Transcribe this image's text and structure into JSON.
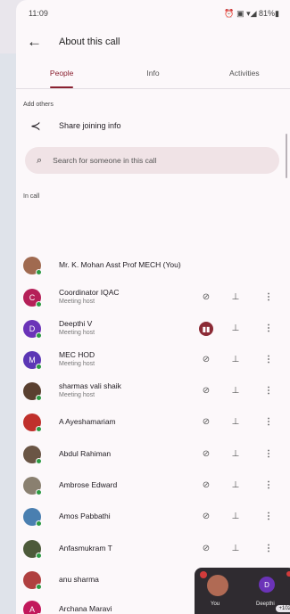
{
  "status": {
    "time": "11:09",
    "icons": "⏰ ▣ ▾◢ 81%▮"
  },
  "header": {
    "title": "About this call"
  },
  "tabs": [
    {
      "label": "People"
    },
    {
      "label": "Info"
    },
    {
      "label": "Activities"
    }
  ],
  "add_section": {
    "label": "Add others",
    "share_label": "Share joining info"
  },
  "search": {
    "placeholder": "Search for someone in this call"
  },
  "incall_label": "In call",
  "participants": [
    {
      "name": "Mr. K. Mohan Asst Prof MECH (You)",
      "sub": "",
      "initial": "",
      "color": "#a06a50"
    },
    {
      "name": "Coordinator IQAC",
      "sub": "Meeting host",
      "initial": "C",
      "color": "#b52058"
    },
    {
      "name": "Deepthi V",
      "sub": "Meeting host",
      "initial": "D",
      "color": "#6b33b8"
    },
    {
      "name": "MEC HOD",
      "sub": "Meeting host",
      "initial": "M",
      "color": "#5c37b5"
    },
    {
      "name": "sharmas vali shaik",
      "sub": "Meeting host",
      "initial": "",
      "color": "#5a4030"
    },
    {
      "name": "A Ayeshamariam",
      "sub": "",
      "initial": "",
      "color": "#c0302c"
    },
    {
      "name": "Abdul Rahiman",
      "sub": "",
      "initial": "",
      "color": "#6a5545"
    },
    {
      "name": "Ambrose Edward",
      "sub": "",
      "initial": "",
      "color": "#8a8070"
    },
    {
      "name": "Amos Pabbathi",
      "sub": "",
      "initial": "",
      "color": "#4a7fb0"
    },
    {
      "name": "Anfasmukram T",
      "sub": "",
      "initial": "",
      "color": "#4d5a3a"
    },
    {
      "name": "anu sharma",
      "sub": "",
      "initial": "",
      "color": "#b04040"
    },
    {
      "name": "Archana Maravi",
      "sub": "",
      "initial": "A",
      "color": "#c2185b"
    }
  ],
  "pip": {
    "you_label": "You",
    "other_label": "Deepthi",
    "other_initial": "D",
    "count": "+102"
  }
}
